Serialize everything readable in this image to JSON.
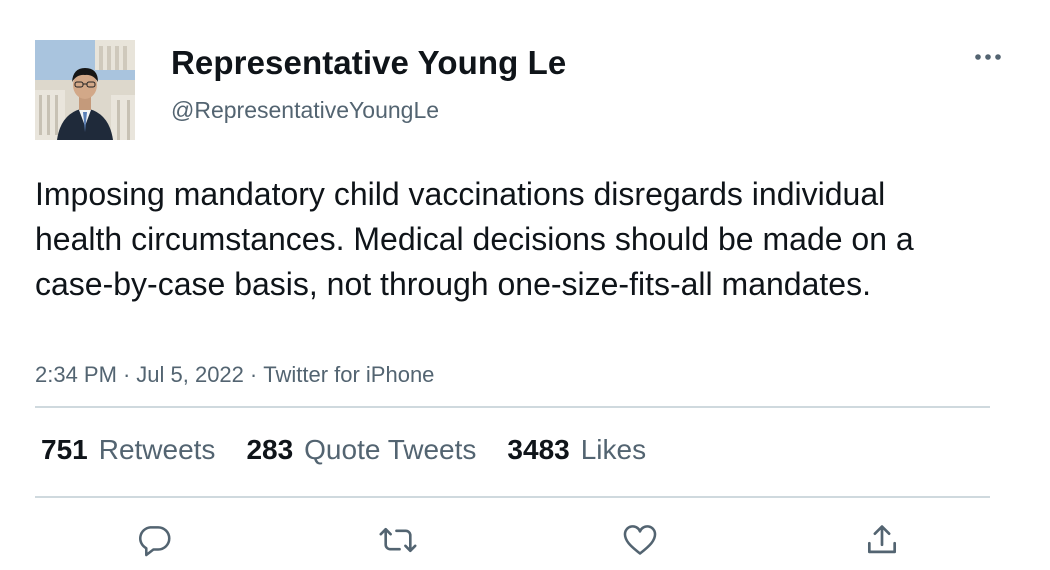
{
  "author": {
    "display_name": "Representative Young Le",
    "handle": "@RepresentativeYoungLe"
  },
  "tweet": {
    "text": "Imposing mandatory child vaccinations disregards individual health circumstances. Medical decisions should be made on a case-by-case basis, not through one-size-fits-all mandates.",
    "time": "2:34 PM",
    "date": "Jul 5, 2022",
    "separator": "·",
    "source": "Twitter for iPhone"
  },
  "stats": {
    "retweets": {
      "count": "751",
      "label": "Retweets"
    },
    "quote_tweets": {
      "count": "283",
      "label": "Quote Tweets"
    },
    "likes": {
      "count": "3483",
      "label": "Likes"
    }
  },
  "icons": {
    "more": "more-horizontal-icon",
    "reply": "reply-icon",
    "retweet": "retweet-icon",
    "like": "heart-icon",
    "share": "share-icon"
  },
  "colors": {
    "text_primary": "#0f1419",
    "text_secondary": "#536471",
    "divider": "#cfd9de",
    "icon": "#536471"
  }
}
